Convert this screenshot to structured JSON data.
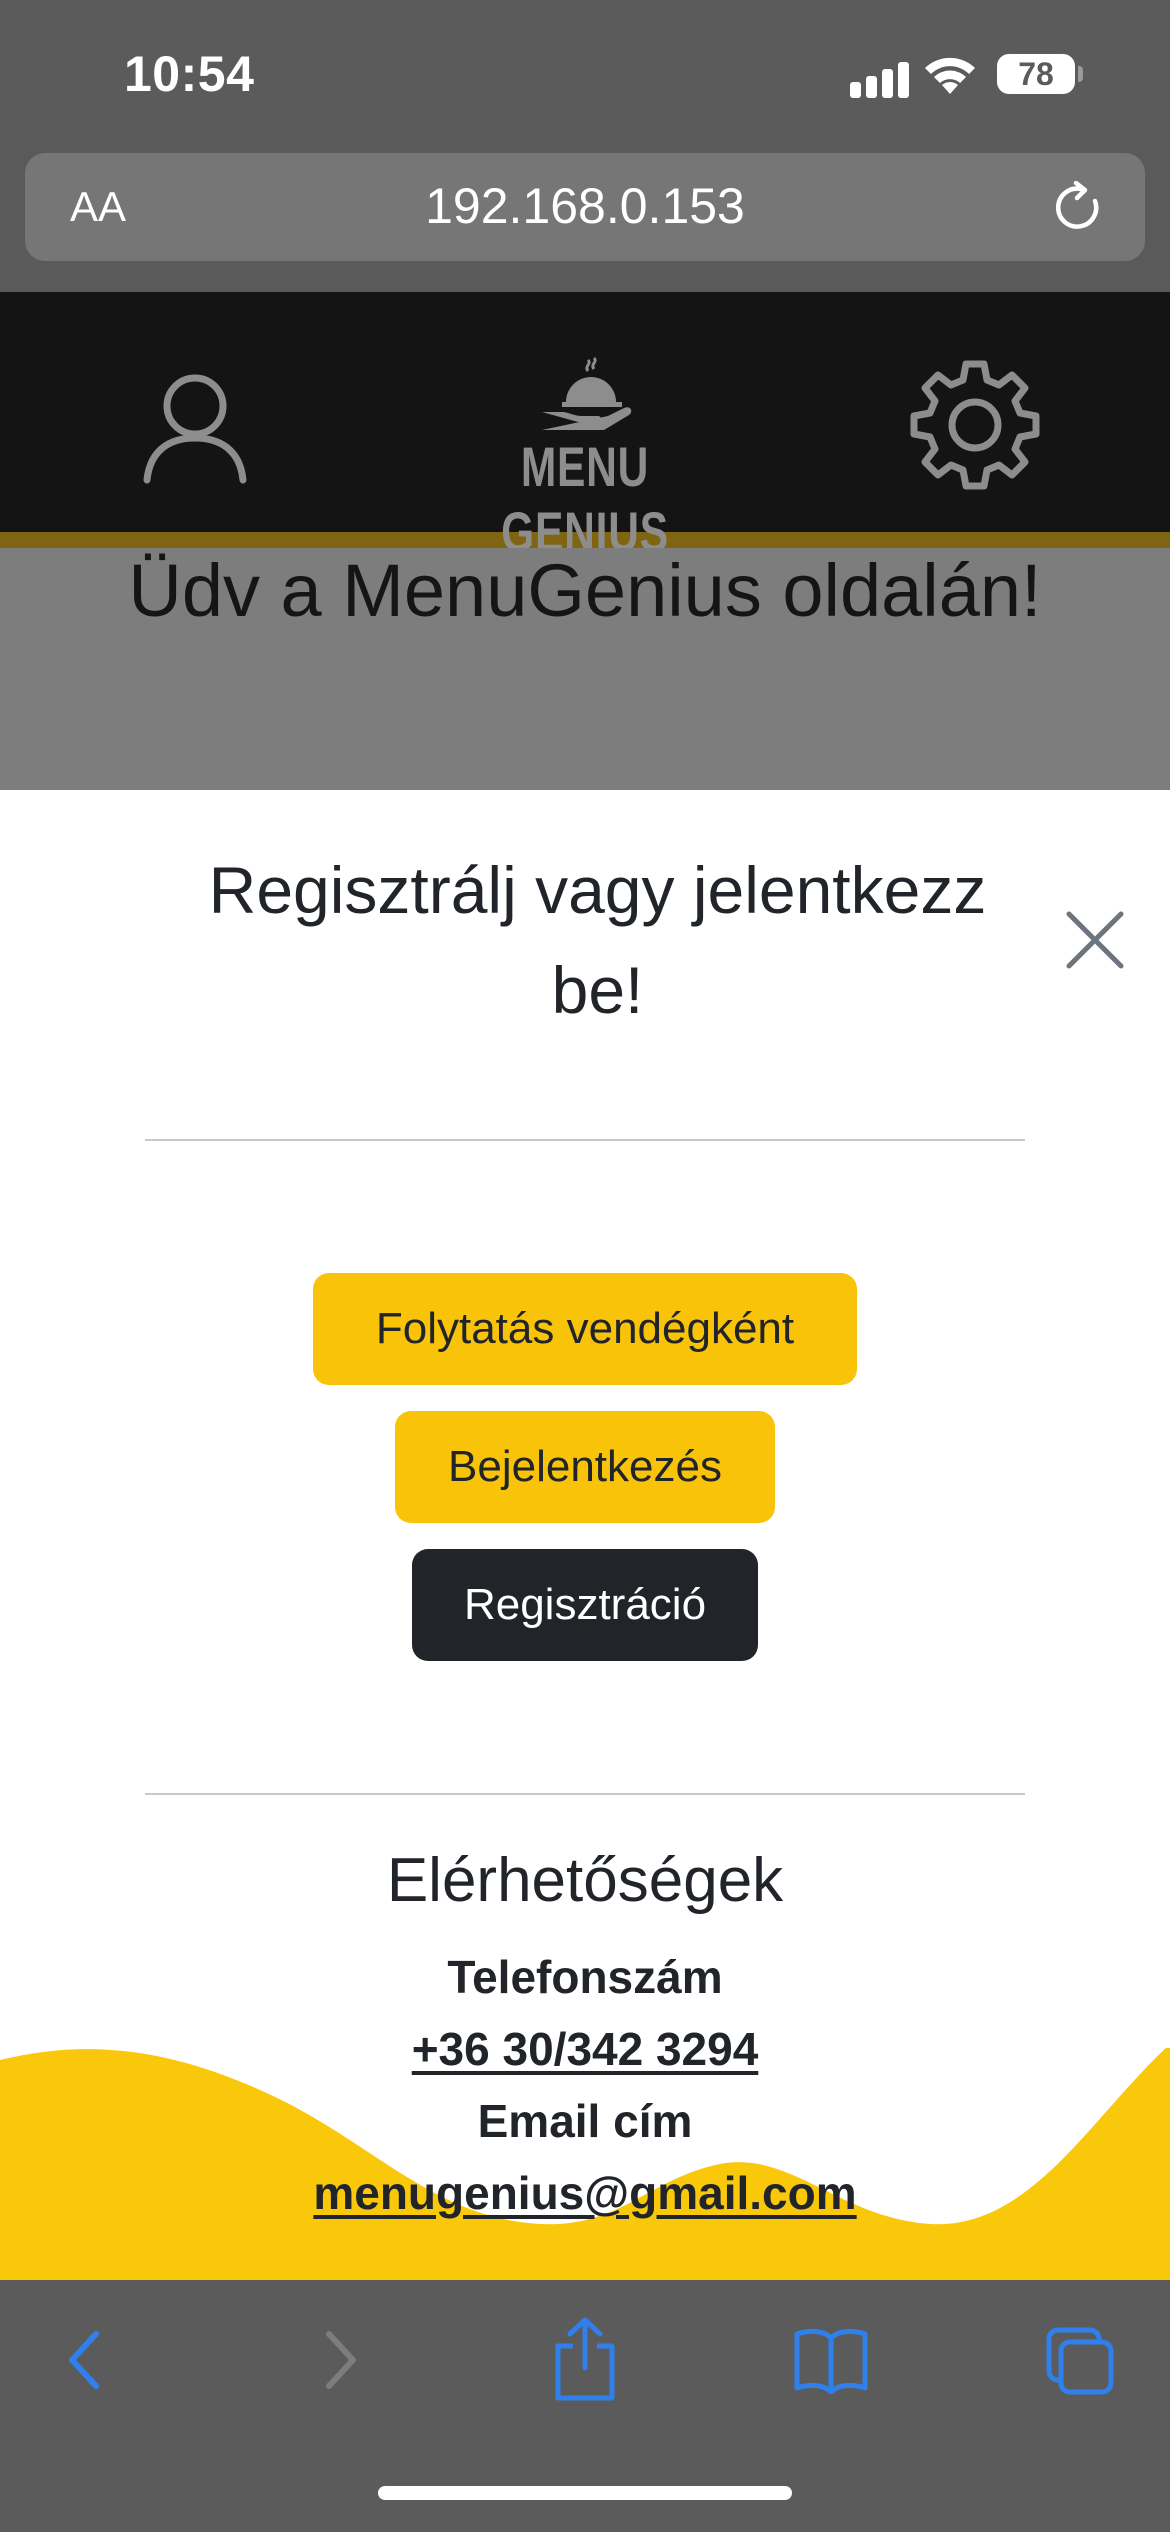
{
  "status_bar": {
    "time": "10:54",
    "battery": "78"
  },
  "browser": {
    "text_size_button": "AA",
    "url": "192.168.0.153"
  },
  "header": {
    "logo_text": "MENU GENIUS"
  },
  "page": {
    "welcome_title": "Üdv a MenuGenius oldalán!"
  },
  "modal": {
    "title": "Regisztrálj vagy jelentkezz be!",
    "buttons": {
      "guest": "Folytatás vendégként",
      "login": "Bejelentkezés",
      "register": "Regisztráció"
    },
    "contact": {
      "title": "Elérhetőségek",
      "phone_label": "Telefonszám",
      "phone_value": "+36 30/342 3294",
      "email_label": "Email cím",
      "email_value": "menugenius@gmail.com"
    }
  },
  "colors": {
    "accent_yellow": "#f9c30a",
    "dark_button": "#212529",
    "header_bg": "#141414",
    "safari_blue": "#2f80ed"
  }
}
